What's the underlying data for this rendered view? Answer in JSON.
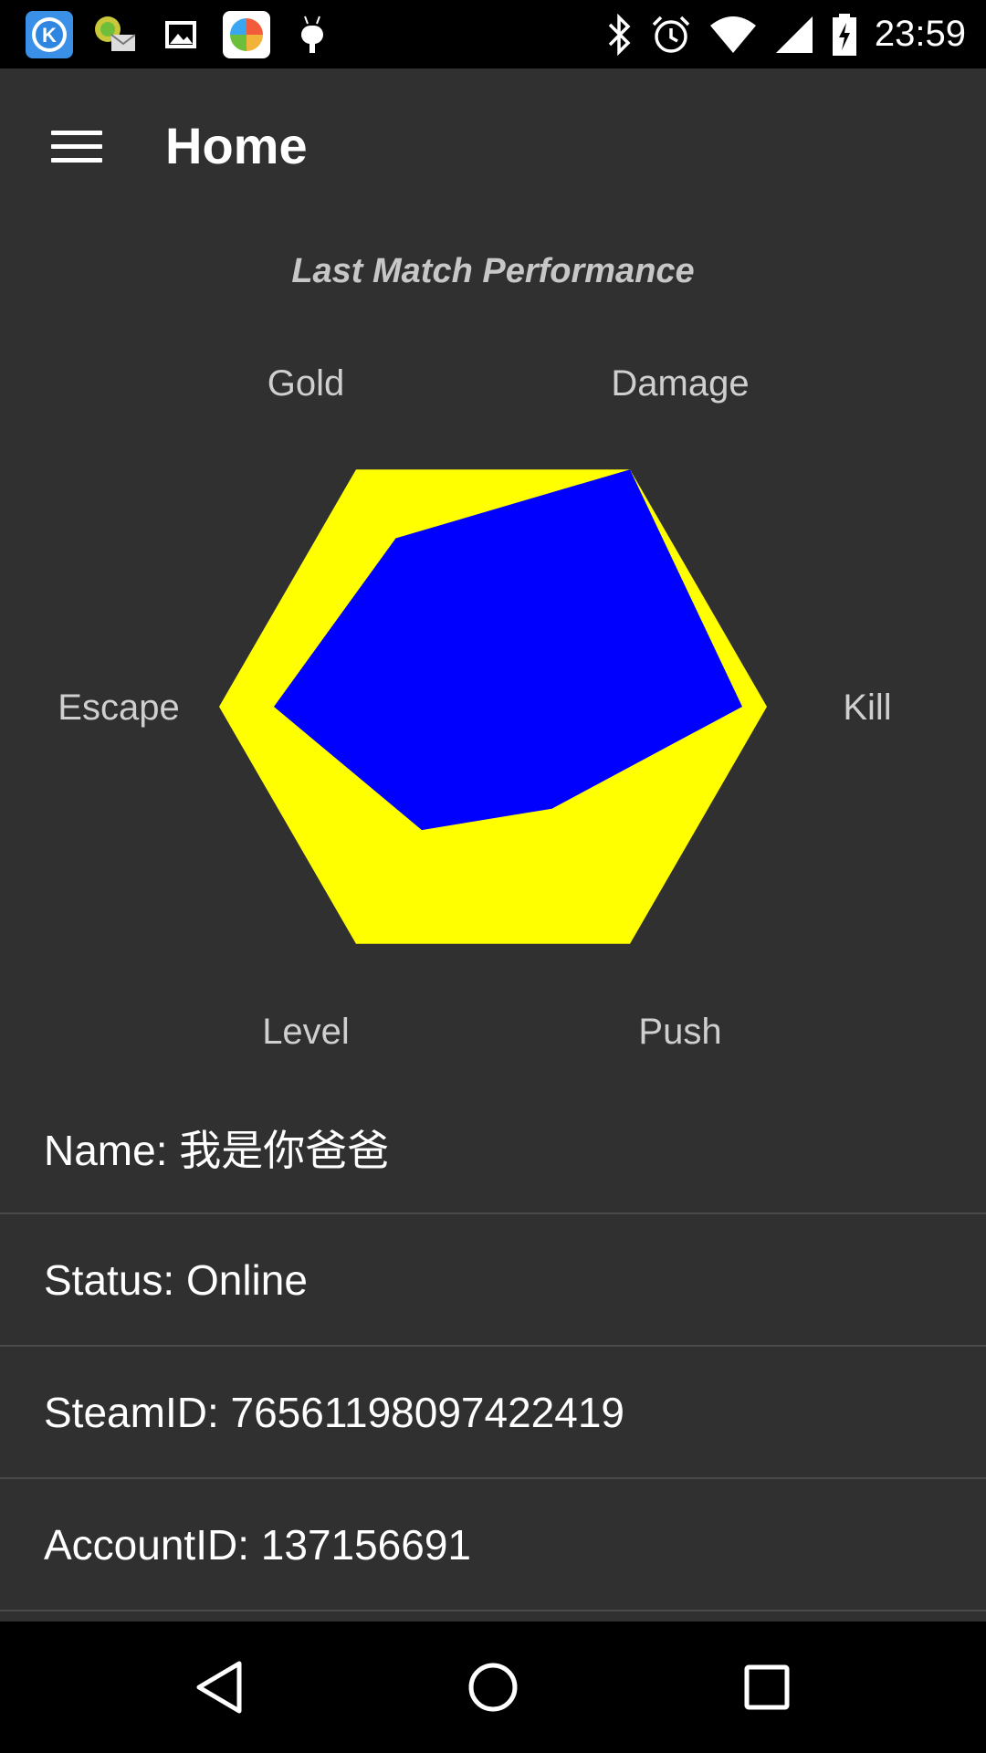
{
  "status_bar": {
    "time": "23:59",
    "app_icons": [
      "k-app-icon",
      "mail-gift-icon",
      "gallery-icon",
      "pinwheel-app-icon",
      "android-debug-icon"
    ],
    "system_icons": [
      "bluetooth-icon",
      "alarm-icon",
      "wifi-icon",
      "signal-icon",
      "battery-charging-icon"
    ]
  },
  "app_bar": {
    "title": "Home",
    "menu_icon": "hamburger-menu-icon"
  },
  "chart_data": {
    "type": "radar",
    "title": "Last Match Performance",
    "axes": [
      "Gold",
      "Damage",
      "Kill",
      "Push",
      "Level",
      "Escape"
    ],
    "series": [
      {
        "values": [
          1,
          1,
          1,
          1,
          1,
          1
        ],
        "color": "#ffff00"
      },
      {
        "values": [
          0.71,
          1.0,
          0.91,
          0.43,
          0.52,
          0.8
        ],
        "color": "#0000ff"
      }
    ],
    "rmax": 1
  },
  "profile": {
    "name": "Name: 我是你爸爸",
    "status": "Status: Online",
    "steam_id": "SteamID: 76561198097422419",
    "account_id": "AccountID: 137156691"
  },
  "nav_bar": {
    "icons": [
      "back-icon",
      "home-icon",
      "recents-icon"
    ]
  },
  "colors": {
    "background": "#303030",
    "status_bar": "#000000",
    "nav_bar": "#000000",
    "divider": "#4a4a4a",
    "chart_label": "#cfcfcf"
  }
}
